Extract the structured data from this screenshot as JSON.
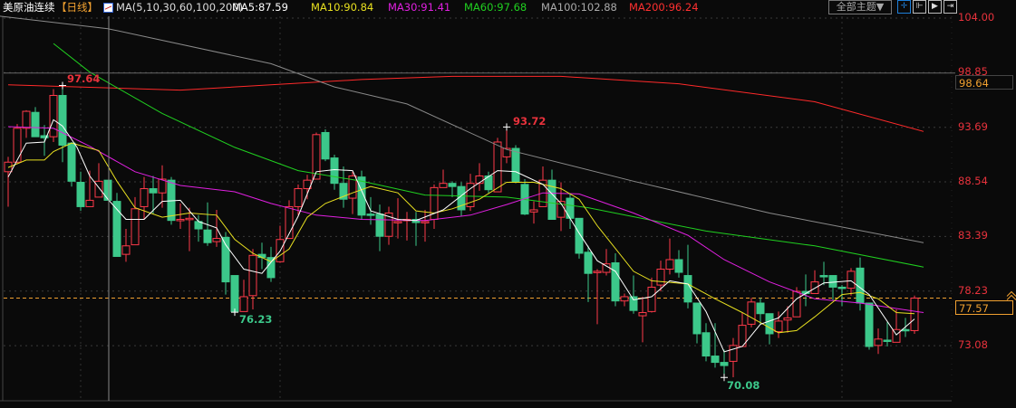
{
  "header": {
    "instrument": "美原油连续",
    "period": "【日线】",
    "ma_params": "MA(5,10,30,60,100,200)",
    "ma5": "MA5:87.59",
    "ma10": "MA10:90.84",
    "ma30": "MA30:91.41",
    "ma60": "MA60:97.68",
    "ma100": "MA100:102.88",
    "ma200": "MA200:96.24",
    "theme_button": "全部主题▼",
    "tools": [
      "crosshair-icon",
      "range-icon",
      "play-icon",
      "move-right-icon"
    ]
  },
  "colors": {
    "up": "#ff3a4a",
    "down": "#3cc88a",
    "ma5": "#ffffff",
    "ma10": "#e8e020",
    "ma30": "#e020e0",
    "ma60": "#20d020",
    "ma100": "#8a8a8a",
    "ma200": "#ff2a2a",
    "axis": "#e8323c",
    "current": "#f0a030"
  },
  "chart_data": {
    "type": "candlestick",
    "title": "美原油连续 日线",
    "ylim": [
      68,
      104
    ],
    "yticks": [
      "104.00",
      "98.85",
      "93.69",
      "88.54",
      "83.39",
      "78.23",
      "73.08"
    ],
    "ytick_values": [
      104.0,
      98.85,
      93.69,
      88.54,
      83.39,
      78.23,
      73.08
    ],
    "crosshair": {
      "value_label": "98.64",
      "value": 98.64,
      "candle_index": 11
    },
    "current_price": {
      "label": "77.57",
      "value": 77.57
    },
    "annotations": {
      "high1": {
        "label": "97.64",
        "value": 97.64,
        "candle_index": 6
      },
      "high2": {
        "label": "93.72",
        "value": 93.72,
        "candle_index": 55
      },
      "low1": {
        "label": "76.23",
        "value": 76.23,
        "candle_index": 25
      },
      "low2": {
        "label": "70.08",
        "value": 70.08,
        "candle_index": 79
      }
    },
    "ohlc": [
      [
        89.5,
        90.9,
        86.2,
        90.4
      ],
      [
        90.4,
        94.0,
        90.3,
        93.6
      ],
      [
        93.6,
        95.3,
        92.7,
        95.2
      ],
      [
        95.1,
        95.6,
        92.8,
        92.8
      ],
      [
        92.9,
        93.9,
        91.0,
        92.7
      ],
      [
        92.8,
        97.3,
        92.3,
        96.7
      ],
      [
        96.7,
        97.64,
        90.4,
        92.0
      ],
      [
        92.2,
        92.3,
        88.1,
        88.6
      ],
      [
        88.5,
        89.5,
        85.8,
        86.2
      ],
      [
        86.2,
        89.6,
        86.2,
        86.8
      ],
      [
        87.1,
        90.3,
        87.1,
        88.6
      ],
      [
        88.7,
        88.7,
        86.8,
        86.8
      ],
      [
        86.7,
        87.5,
        81.5,
        81.5
      ],
      [
        81.7,
        84.1,
        81.0,
        82.5
      ],
      [
        82.6,
        87.1,
        82.6,
        86.0
      ],
      [
        86.2,
        89.0,
        85.0,
        87.9
      ],
      [
        87.9,
        89.1,
        85.5,
        87.5
      ],
      [
        87.5,
        90.1,
        86.1,
        88.8
      ],
      [
        88.7,
        89.0,
        84.5,
        84.9
      ],
      [
        84.9,
        86.5,
        84.1,
        85.0
      ],
      [
        85.0,
        86.1,
        82.0,
        85.1
      ],
      [
        84.8,
        85.4,
        82.9,
        84.1
      ],
      [
        84.0,
        86.6,
        82.5,
        82.8
      ],
      [
        82.9,
        85.9,
        82.4,
        83.2
      ],
      [
        83.3,
        83.8,
        77.9,
        79.1
      ],
      [
        79.7,
        79.7,
        76.23,
        76.3
      ],
      [
        76.3,
        79.3,
        76.3,
        77.7
      ],
      [
        77.8,
        82.2,
        76.5,
        81.6
      ],
      [
        81.7,
        82.8,
        80.3,
        81.4
      ],
      [
        81.4,
        82.4,
        79.1,
        79.5
      ],
      [
        81.0,
        84.4,
        80.9,
        83.1
      ],
      [
        83.2,
        86.8,
        83.2,
        86.2
      ],
      [
        86.2,
        88.3,
        85.4,
        87.9
      ],
      [
        87.9,
        89.2,
        86.9,
        88.7
      ],
      [
        88.8,
        93.2,
        88.8,
        93.0
      ],
      [
        93.2,
        93.5,
        90.5,
        90.7
      ],
      [
        90.8,
        91.1,
        87.8,
        88.4
      ],
      [
        88.4,
        90.0,
        86.1,
        86.9
      ],
      [
        87.0,
        89.5,
        85.5,
        89.1
      ],
      [
        89.0,
        89.6,
        85.0,
        85.4
      ],
      [
        85.5,
        87.1,
        84.5,
        85.4
      ],
      [
        85.5,
        86.4,
        82.0,
        83.4
      ],
      [
        83.4,
        86.2,
        82.6,
        85.6
      ],
      [
        84.7,
        87.0,
        83.2,
        84.8
      ],
      [
        84.9,
        85.7,
        83.0,
        85.0
      ],
      [
        85.0,
        85.7,
        82.5,
        84.7
      ],
      [
        84.7,
        85.9,
        82.9,
        84.8
      ],
      [
        85.0,
        88.3,
        84.1,
        88.0
      ],
      [
        88.0,
        89.7,
        88.0,
        88.4
      ],
      [
        88.4,
        88.6,
        87.1,
        88.1
      ],
      [
        88.1,
        88.5,
        85.3,
        85.9
      ],
      [
        86.2,
        89.3,
        85.8,
        88.4
      ],
      [
        88.4,
        90.3,
        87.7,
        89.1
      ],
      [
        89.1,
        89.5,
        87.5,
        87.8
      ],
      [
        87.6,
        92.7,
        87.6,
        92.3
      ],
      [
        90.9,
        93.72,
        90.3,
        91.7
      ],
      [
        91.7,
        92.0,
        88.4,
        88.5
      ],
      [
        88.3,
        88.8,
        85.4,
        85.5
      ],
      [
        85.7,
        86.7,
        84.6,
        85.9
      ],
      [
        86.2,
        90.0,
        86.2,
        88.7
      ],
      [
        88.7,
        89.7,
        85.0,
        85.0
      ],
      [
        85.2,
        88.5,
        83.9,
        86.7
      ],
      [
        87.0,
        87.4,
        84.1,
        85.1
      ],
      [
        85.1,
        85.1,
        81.3,
        81.8
      ],
      [
        81.9,
        82.5,
        77.2,
        79.9
      ],
      [
        80.0,
        80.3,
        75.1,
        80.1
      ],
      [
        80.0,
        82.2,
        79.7,
        80.8
      ],
      [
        80.9,
        81.8,
        76.8,
        77.3
      ],
      [
        77.3,
        78.0,
        76.8,
        77.7
      ],
      [
        77.7,
        79.7,
        76.1,
        76.4
      ],
      [
        75.9,
        77.7,
        73.4,
        76.2
      ],
      [
        76.3,
        79.5,
        76.2,
        78.6
      ],
      [
        78.8,
        81.1,
        78.2,
        80.3
      ],
      [
        80.3,
        83.2,
        79.8,
        81.2
      ],
      [
        81.2,
        82.1,
        79.5,
        80.0
      ],
      [
        79.7,
        82.6,
        76.6,
        77.2
      ],
      [
        77.1,
        77.1,
        73.3,
        74.2
      ],
      [
        74.3,
        75.2,
        71.6,
        72.1
      ],
      [
        72.1,
        75.2,
        71.0,
        71.5
      ],
      [
        71.5,
        72.7,
        70.08,
        71.2
      ],
      [
        71.6,
        73.8,
        70.1,
        73.1
      ],
      [
        73.0,
        76.2,
        73.0,
        75.0
      ],
      [
        75.1,
        77.6,
        74.8,
        77.2
      ],
      [
        77.1,
        77.6,
        75.1,
        76.1
      ],
      [
        76.1,
        76.1,
        73.2,
        74.2
      ],
      [
        74.4,
        76.3,
        73.8,
        75.4
      ],
      [
        75.5,
        76.8,
        74.3,
        75.7
      ],
      [
        75.8,
        78.6,
        75.8,
        78.2
      ],
      [
        78.2,
        79.8,
        76.8,
        78.0
      ],
      [
        78.0,
        80.2,
        78.0,
        79.1
      ],
      [
        79.7,
        81.0,
        78.8,
        79.6
      ],
      [
        79.7,
        79.7,
        77.4,
        78.6
      ],
      [
        78.6,
        78.8,
        76.8,
        78.5
      ],
      [
        78.5,
        80.4,
        77.8,
        80.1
      ],
      [
        80.4,
        81.4,
        76.4,
        77.1
      ],
      [
        77.1,
        77.1,
        72.7,
        73.0
      ],
      [
        73.1,
        74.7,
        72.3,
        73.7
      ],
      [
        73.6,
        75.3,
        73.0,
        73.5
      ],
      [
        73.4,
        76.5,
        73.4,
        74.6
      ],
      [
        74.6,
        75.7,
        73.9,
        74.5
      ],
      [
        74.5,
        77.8,
        74.2,
        77.57
      ]
    ],
    "ma_series": [
      {
        "name": "MA200",
        "color_key": "ma200",
        "points": [
          [
            0,
            97.7
          ],
          [
            19,
            97.2
          ],
          [
            39,
            98.2
          ],
          [
            49,
            98.5
          ],
          [
            61,
            98.5
          ],
          [
            74,
            97.8
          ],
          [
            89,
            96.1
          ],
          [
            101,
            93.3
          ]
        ]
      },
      {
        "name": "MA100",
        "color_key": "ma100",
        "points": [
          [
            -1,
            104.2
          ],
          [
            11,
            103.0
          ],
          [
            29,
            99.7
          ],
          [
            36,
            97.5
          ],
          [
            44,
            95.9
          ],
          [
            55,
            91.6
          ],
          [
            69,
            88.6
          ],
          [
            84,
            85.6
          ],
          [
            101,
            82.8
          ]
        ]
      },
      {
        "name": "MA60",
        "color_key": "ma60",
        "points": [
          [
            5,
            101.6
          ],
          [
            9,
            98.9
          ],
          [
            17,
            95.0
          ],
          [
            25,
            91.8
          ],
          [
            32,
            89.6
          ],
          [
            39,
            88.6
          ],
          [
            46,
            87.3
          ],
          [
            55,
            87.1
          ],
          [
            64,
            86.1
          ],
          [
            77,
            83.9
          ],
          [
            89,
            82.5
          ],
          [
            101,
            80.5
          ]
        ]
      },
      {
        "name": "MA30",
        "color_key": "ma30",
        "points": [
          [
            0,
            93.75
          ],
          [
            5,
            93.6
          ],
          [
            9,
            91.9
          ],
          [
            14,
            89.5
          ],
          [
            19,
            88.2
          ],
          [
            25,
            87.6
          ],
          [
            29,
            86.5
          ],
          [
            34,
            85.4
          ],
          [
            39,
            85.0
          ],
          [
            46,
            84.9
          ],
          [
            51,
            85.4
          ],
          [
            55,
            86.4
          ],
          [
            59,
            87.5
          ],
          [
            63,
            87.4
          ],
          [
            69,
            85.6
          ],
          [
            75,
            83.5
          ],
          [
            79,
            81.2
          ],
          [
            84,
            79.1
          ],
          [
            89,
            77.5
          ],
          [
            94,
            77.1
          ],
          [
            101,
            76.2
          ]
        ]
      },
      {
        "name": "MA10",
        "color_key": "ma10",
        "points": [
          [
            0,
            89.9
          ],
          [
            2,
            90.6
          ],
          [
            4,
            90.6
          ],
          [
            5,
            91.4
          ],
          [
            7,
            92.2
          ],
          [
            10,
            91.5
          ],
          [
            12,
            88.6
          ],
          [
            14,
            86.1
          ],
          [
            17,
            85.2
          ],
          [
            20,
            85.6
          ],
          [
            23,
            85.4
          ],
          [
            25,
            83.1
          ],
          [
            27,
            81.8
          ],
          [
            29,
            81.0
          ],
          [
            31,
            82.2
          ],
          [
            33,
            85.2
          ],
          [
            35,
            86.5
          ],
          [
            38,
            87.5
          ],
          [
            40,
            88.1
          ],
          [
            43,
            87.5
          ],
          [
            45,
            85.8
          ],
          [
            47,
            85.6
          ],
          [
            49,
            86.0
          ],
          [
            52,
            86.9
          ],
          [
            55,
            88.5
          ],
          [
            58,
            88.5
          ],
          [
            61,
            87.9
          ],
          [
            63,
            86.9
          ],
          [
            65,
            84.4
          ],
          [
            69,
            80.1
          ],
          [
            71,
            79.2
          ],
          [
            75,
            78.9
          ],
          [
            78,
            77.5
          ],
          [
            81,
            76.2
          ],
          [
            85,
            74.3
          ],
          [
            87,
            74.5
          ],
          [
            89,
            75.8
          ],
          [
            92,
            77.9
          ],
          [
            94,
            78.1
          ],
          [
            96,
            77.5
          ],
          [
            98,
            76.2
          ],
          [
            100,
            76.1
          ]
        ]
      },
      {
        "name": "MA5",
        "color_key": "ma5",
        "points": [
          [
            0,
            89.0
          ],
          [
            2,
            92.2
          ],
          [
            4,
            92.3
          ],
          [
            5,
            94.4
          ],
          [
            6,
            93.8
          ],
          [
            7.6,
            91.8
          ],
          [
            9,
            89.1
          ],
          [
            11,
            86.9
          ],
          [
            13,
            85.0
          ],
          [
            15,
            85.0
          ],
          [
            17,
            86.7
          ],
          [
            19,
            86.8
          ],
          [
            21,
            84.8
          ],
          [
            23,
            84.2
          ],
          [
            24,
            82.6
          ],
          [
            26,
            80.3
          ],
          [
            28,
            79.9
          ],
          [
            30,
            82.0
          ],
          [
            32,
            85.3
          ],
          [
            34,
            89.5
          ],
          [
            36,
            89.7
          ],
          [
            38,
            89.6
          ],
          [
            40,
            85.8
          ],
          [
            43,
            85.0
          ],
          [
            45,
            84.9
          ],
          [
            48,
            85.9
          ],
          [
            51,
            87.9
          ],
          [
            54,
            89.6
          ],
          [
            56,
            89.5
          ],
          [
            59,
            88.3
          ],
          [
            61,
            86.5
          ],
          [
            63,
            83.7
          ],
          [
            65,
            81.1
          ],
          [
            67,
            80.1
          ],
          [
            69,
            77.4
          ],
          [
            71,
            77.7
          ],
          [
            73,
            79.2
          ],
          [
            75,
            78.9
          ],
          [
            77,
            76.3
          ],
          [
            79,
            72.5
          ],
          [
            81,
            73.0
          ],
          [
            83,
            75.1
          ],
          [
            85,
            75.7
          ],
          [
            87,
            77.5
          ],
          [
            90,
            79.0
          ],
          [
            93,
            79.2
          ],
          [
            95,
            77.9
          ],
          [
            98,
            74.1
          ],
          [
            100,
            75.6
          ]
        ]
      }
    ]
  }
}
